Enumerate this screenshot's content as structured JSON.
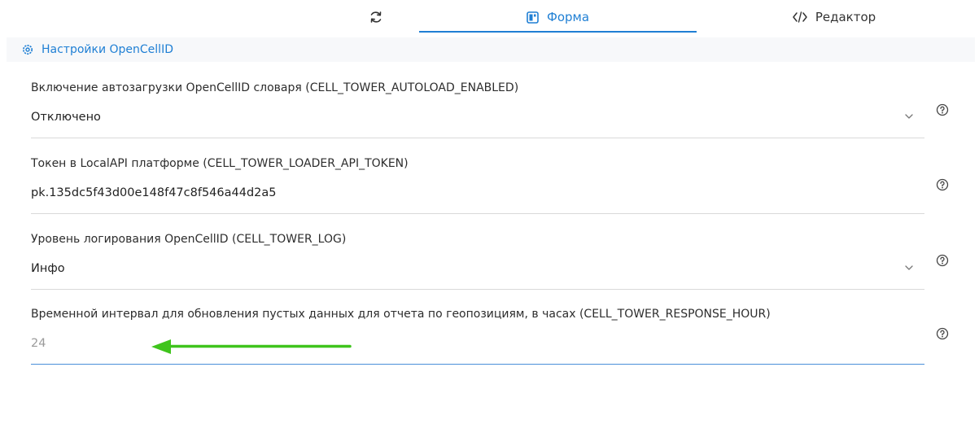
{
  "tabs": {
    "refresh_icon": "refresh-icon",
    "form_label": "Форма",
    "editor_label": "Редактор",
    "active_color": "#1f7fd4"
  },
  "section": {
    "title": "Настройки OpenCellID"
  },
  "fields": [
    {
      "label": "Включение автозагрузки OpenCellID словаря (CELL_TOWER_AUTOLOAD_ENABLED)",
      "value": "Отключено",
      "type": "select"
    },
    {
      "label": "Токен в LocalAPI платформе (CELL_TOWER_LOADER_API_TOKEN)",
      "value": "pk.135dc5f43d00e148f47c8f546a44d2a5",
      "type": "text"
    },
    {
      "label": "Уровень логирования OpenCellID (CELL_TOWER_LOG)",
      "value": "Инфо",
      "type": "select"
    },
    {
      "label": "Временной интервал для обновления пустых данных для отчета по геопозициям, в часах (CELL_TOWER_RESPONSE_HOUR)",
      "value": "24",
      "type": "text"
    }
  ],
  "annotation": {
    "arrow_color": "#3fc41c"
  }
}
